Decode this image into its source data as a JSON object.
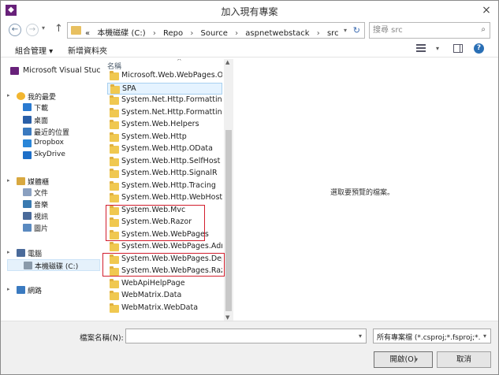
{
  "window": {
    "title": "加入現有專案",
    "close_glyph": "×",
    "app_icon_glyph": "◆"
  },
  "address": {
    "overflow": "«",
    "crumbs": [
      "本機磁碟 (C:)",
      "Repo",
      "Source",
      "aspnetwebstack",
      "src"
    ],
    "separator": "›",
    "back_glyph": "←",
    "forward_glyph": "→",
    "up_glyph": "↑",
    "dropdown_glyph": "▾",
    "refresh_glyph": "↻"
  },
  "search": {
    "placeholder": "搜尋 src",
    "icon_glyph": "⌕"
  },
  "toolbar": {
    "organize_label": "組合管理 ▾",
    "new_folder_label": "新增資料夾",
    "view_drop": "▾",
    "help_glyph": "?"
  },
  "nav": {
    "items": [
      {
        "label": "Microsoft Visual Stuc",
        "kind": "top",
        "icon": "visual-studio-icon"
      },
      {
        "label": "我的最愛",
        "kind": "hdr",
        "icon": "star-icon"
      },
      {
        "label": "下載",
        "kind": "child",
        "icon": "download-icon"
      },
      {
        "label": "桌面",
        "kind": "child",
        "icon": "desktop-icon"
      },
      {
        "label": "最近的位置",
        "kind": "child",
        "icon": "recent-places-icon"
      },
      {
        "label": "Dropbox",
        "kind": "child",
        "icon": "dropbox-icon"
      },
      {
        "label": "SkyDrive",
        "kind": "child",
        "icon": "skydrive-icon"
      },
      {
        "label": "媒體櫃",
        "kind": "hdr",
        "icon": "library-icon"
      },
      {
        "label": "文件",
        "kind": "child",
        "icon": "documents-icon"
      },
      {
        "label": "音樂",
        "kind": "child",
        "icon": "music-icon"
      },
      {
        "label": "視訊",
        "kind": "child",
        "icon": "video-icon"
      },
      {
        "label": "圖片",
        "kind": "child",
        "icon": "pictures-icon"
      },
      {
        "label": "電腦",
        "kind": "hdr",
        "icon": "computer-icon"
      },
      {
        "label": "本機磁碟 (C:)",
        "kind": "child",
        "icon": "drive-icon"
      },
      {
        "label": "網路",
        "kind": "hdr",
        "icon": "network-icon"
      }
    ],
    "expand_glyph": "▸"
  },
  "filelist": {
    "column_name": "名稱",
    "sort_glyph": "^",
    "items": [
      "Microsoft.Web.WebPages.OAuth",
      "SPA",
      "System.Net.Http.Formatting",
      "System.Net.Http.Formatting.NetCore",
      "System.Web.Helpers",
      "System.Web.Http",
      "System.Web.Http.OData",
      "System.Web.Http.SelfHost",
      "System.Web.Http.SignalR",
      "System.Web.Http.Tracing",
      "System.Web.Http.WebHost",
      "System.Web.Mvc",
      "System.Web.Razor",
      "System.Web.WebPages",
      "System.Web.WebPages.Administration",
      "System.Web.WebPages.Deployment",
      "System.Web.WebPages.Razor",
      "WebApiHelpPage",
      "WebMatrix.Data",
      "WebMatrix.WebData"
    ],
    "selected_index": 1,
    "scroll_up_glyph": "▲",
    "scroll_down_glyph": "▼"
  },
  "preview": {
    "message": "選取要預覽的檔案。"
  },
  "bottom": {
    "filename_label": "檔案名稱(N):",
    "filename_value": "",
    "filter_value": "所有專案檔 (*.csproj;*.fsproj;*.",
    "open_label": "開啟(O)",
    "cancel_label": "取消",
    "drop_glyph": "▾"
  }
}
